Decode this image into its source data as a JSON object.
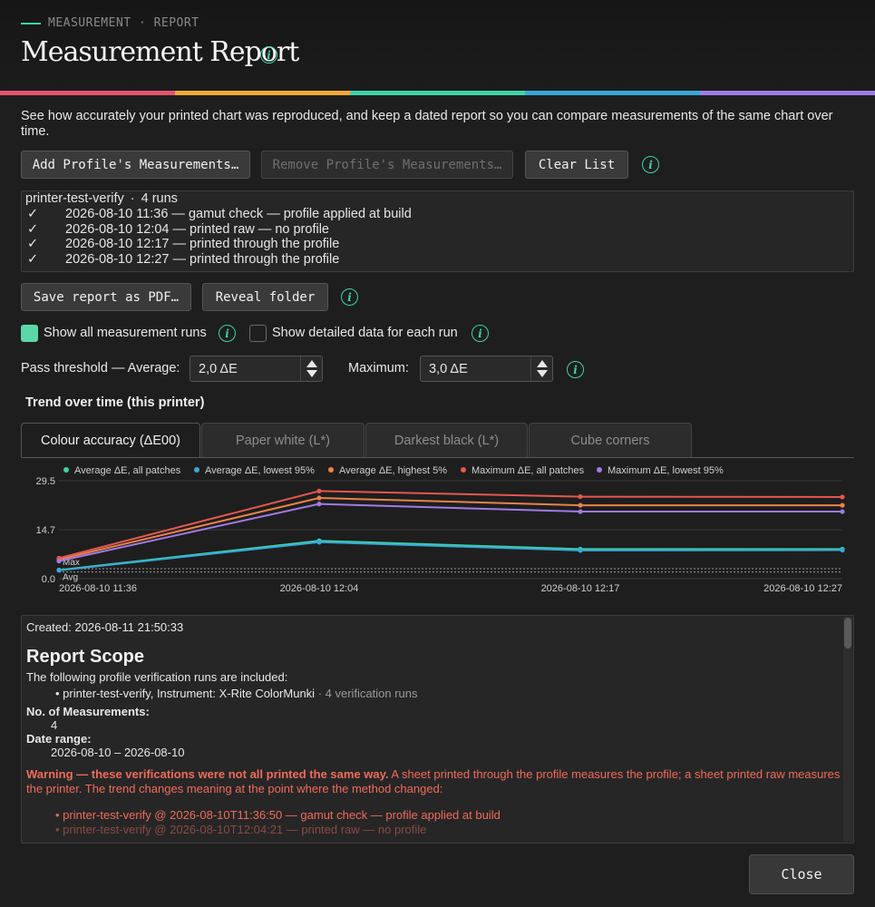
{
  "header": {
    "eyebrow": "MEASUREMENT · REPORT",
    "title": "Measurement Report"
  },
  "colors": {
    "accent": "#3fd3a8",
    "stripe": [
      "#e5546c",
      "#f2a93b",
      "#3fd3a8",
      "#3aa7d6",
      "#a07be6"
    ]
  },
  "description": "See how accurately your printed chart was reproduced, and keep a dated report so you can compare measurements of the same chart over time.",
  "actions": {
    "add_label": "Add Profile's Measurements…",
    "remove_label": "Remove Profile's Measurements…",
    "clear_label": "Clear List",
    "save_pdf_label": "Save report as PDF…",
    "reveal_label": "Reveal folder",
    "close_label": "Close"
  },
  "runs": {
    "profile": "printer-test-verify",
    "count_label": "4 runs",
    "items": [
      {
        "check": "✓",
        "text": "2026-08-10 11:36 — gamut check — profile applied at build"
      },
      {
        "check": "✓",
        "text": "2026-08-10 12:04 — printed raw — no profile"
      },
      {
        "check": "✓",
        "text": "2026-08-10 12:17 — printed through the profile"
      },
      {
        "check": "✓",
        "text": "2026-08-10 12:27 — printed through the profile"
      }
    ]
  },
  "options": {
    "show_all_label": "Show all measurement runs",
    "show_all_checked": true,
    "show_detail_label": "Show detailed data for each run",
    "show_detail_checked": false
  },
  "threshold": {
    "average_label": "Pass threshold — Average:",
    "average_value": "2,0 ΔE",
    "maximum_label": "Maximum:",
    "maximum_value": "3,0 ΔE"
  },
  "trend": {
    "title": "Trend over time (this printer)",
    "tabs": [
      "Colour accuracy (ΔE00)",
      "Paper white (L*)",
      "Darkest black (L*)",
      "Cube corners"
    ],
    "active_tab": 0
  },
  "chart_data": {
    "type": "line",
    "categories": [
      "2026-08-10 11:36",
      "2026-08-10 12:04",
      "2026-08-10 12:17",
      "2026-08-10 12:27"
    ],
    "yticks": [
      "29.5",
      "14.7",
      "0.0"
    ],
    "ylim": [
      0,
      29.5
    ],
    "grid": true,
    "legend_position": "top",
    "series": [
      {
        "name": "Average ΔE, all patches",
        "color": "#3fd3a8",
        "values": [
          2.6,
          11.4,
          8.9,
          8.9
        ]
      },
      {
        "name": "Average ΔE, lowest 95%",
        "color": "#3aa7d6",
        "values": [
          2.5,
          11.0,
          8.5,
          8.6
        ]
      },
      {
        "name": "Average ΔE, highest 5%",
        "color": "#e8834a",
        "values": [
          5.8,
          24.3,
          22.1,
          22.1
        ]
      },
      {
        "name": "Maximum ΔE, all patches",
        "color": "#e5574f",
        "values": [
          6.2,
          26.4,
          24.7,
          24.6
        ]
      },
      {
        "name": "Maximum ΔE, lowest 95%",
        "color": "#a07be6",
        "values": [
          5.3,
          22.5,
          20.2,
          20.2
        ]
      }
    ],
    "reference_lines": [
      {
        "label": "Max",
        "value": 3.0
      },
      {
        "label": "Avg",
        "value": 2.0
      }
    ]
  },
  "report": {
    "created": "Created: 2026-08-11 21:50:33",
    "scope_title": "Report Scope",
    "scope_intro": "The following profile verification runs are included:",
    "scope_item": "printer-test-verify, Instrument: X-Rite ColorMunki",
    "scope_item_extra": "· 4 verification runs",
    "num_label": "No. of Measurements:",
    "num_value": "4",
    "range_label": "Date range:",
    "range_value": "2026-08-10 – 2026-08-10",
    "warning_bold": "Warning — these verifications were not all printed the same way.",
    "warning_text": " A sheet printed through the profile measures the profile; a sheet printed raw measures the printer. The trend changes meaning at the point where the method changed:",
    "warning_items": [
      "printer-test-verify @ 2026-08-10T11:36:50 — gamut check — profile applied at build",
      "printer-test-verify @ 2026-08-10T12:04:21 — printed raw — no profile"
    ]
  }
}
